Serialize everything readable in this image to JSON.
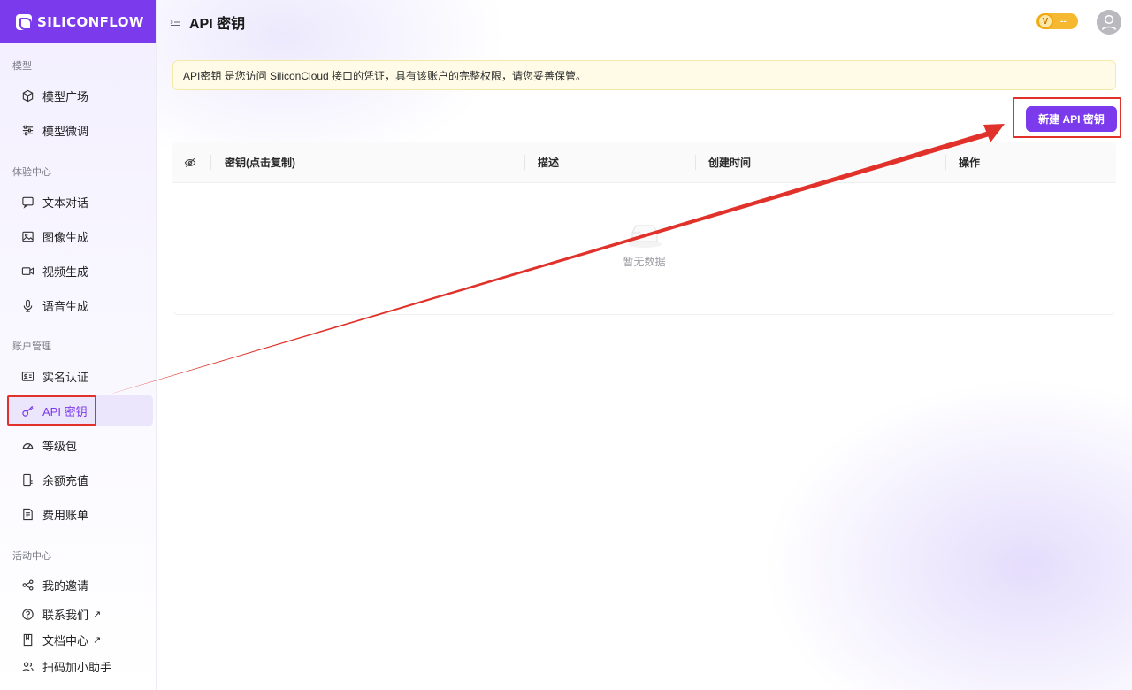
{
  "brand": {
    "name": "SILICONFLOW"
  },
  "header": {
    "title": "API 密钥",
    "badge_text": "--"
  },
  "sidebar": {
    "sections": [
      {
        "title": "模型",
        "items": [
          {
            "label": "模型广场",
            "icon": "cube-icon"
          },
          {
            "label": "模型微调",
            "icon": "sliders-icon"
          }
        ]
      },
      {
        "title": "体验中心",
        "items": [
          {
            "label": "文本对话",
            "icon": "chat-icon"
          },
          {
            "label": "图像生成",
            "icon": "image-icon"
          },
          {
            "label": "视频生成",
            "icon": "video-icon"
          },
          {
            "label": "语音生成",
            "icon": "mic-icon"
          }
        ]
      },
      {
        "title": "账户管理",
        "items": [
          {
            "label": "实名认证",
            "icon": "id-card-icon"
          },
          {
            "label": "API 密钥",
            "icon": "key-icon",
            "active": true
          },
          {
            "label": "等级包",
            "icon": "gauge-icon"
          },
          {
            "label": "余额充值",
            "icon": "wallet-icon"
          },
          {
            "label": "费用账单",
            "icon": "bill-icon"
          }
        ]
      },
      {
        "title": "活动中心",
        "items": [
          {
            "label": "我的邀请",
            "icon": "share-icon"
          },
          {
            "label": "联系我们",
            "icon": "help-icon",
            "external": "↗"
          },
          {
            "label": "文档中心",
            "icon": "book-icon",
            "external": "↗"
          },
          {
            "label": "扫码加小助手",
            "icon": "user-group-icon"
          }
        ]
      }
    ]
  },
  "notice": {
    "text": "API密钥 是您访问 SiliconCloud 接口的凭证，具有该账户的完整权限，请您妥善保管。"
  },
  "actions": {
    "new_key_label": "新建 API 密钥"
  },
  "table": {
    "columns": [
      "密钥(点击复制)",
      "描述",
      "创建时间",
      "操作"
    ],
    "rows": [],
    "empty_text": "暂无数据"
  },
  "colors": {
    "accent": "#7c3aed",
    "annotation": "#e0322a",
    "notice_bg": "#fffbe6",
    "badge": "#f5b82e"
  }
}
